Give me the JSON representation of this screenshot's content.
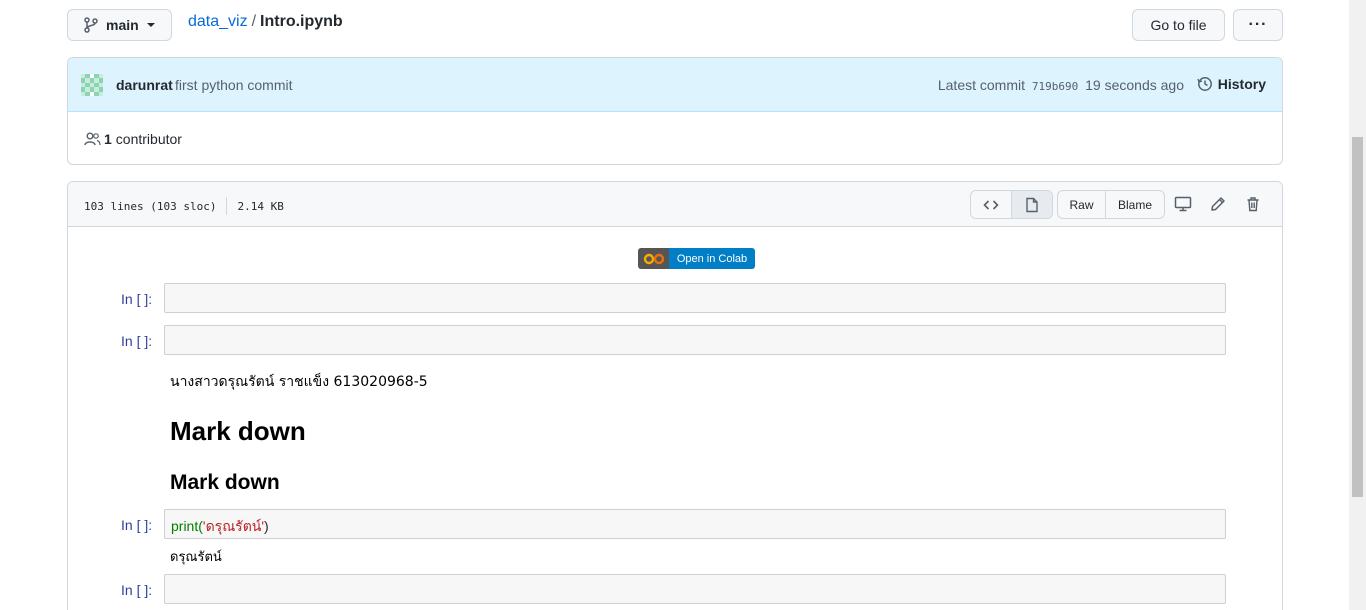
{
  "branch": {
    "name": "main"
  },
  "breadcrumb": {
    "repo": "data_viz",
    "separator": "/",
    "file": "Intro.ipynb"
  },
  "toolbar": {
    "goto_label": "Go to file",
    "more_label": "···"
  },
  "commit": {
    "author": "darunrat",
    "message": "first python commit",
    "latest_label": "Latest commit",
    "sha": "719b690",
    "time": "19 seconds ago",
    "history_label": "History",
    "avatar_colors": [
      "#8bd3b3",
      "#c7ecdb"
    ]
  },
  "contributors": {
    "count": "1",
    "label": "contributor"
  },
  "file": {
    "lines": "103 lines (103 sloc)",
    "size": "2.14 KB",
    "raw_label": "Raw",
    "blame_label": "Blame"
  },
  "notebook": {
    "colab_label": "Open in Colab",
    "prompt": "In [ ]:",
    "thai_line": "นางสาวดรุณรัตน์ ราชแข็ง 613020968-5",
    "h1": "Mark down",
    "h2": "Mark down",
    "code_fn": "print(",
    "code_str": "'ดรุณรัตน์'",
    "code_end": ")",
    "output": "ดรุณรัตน์"
  }
}
